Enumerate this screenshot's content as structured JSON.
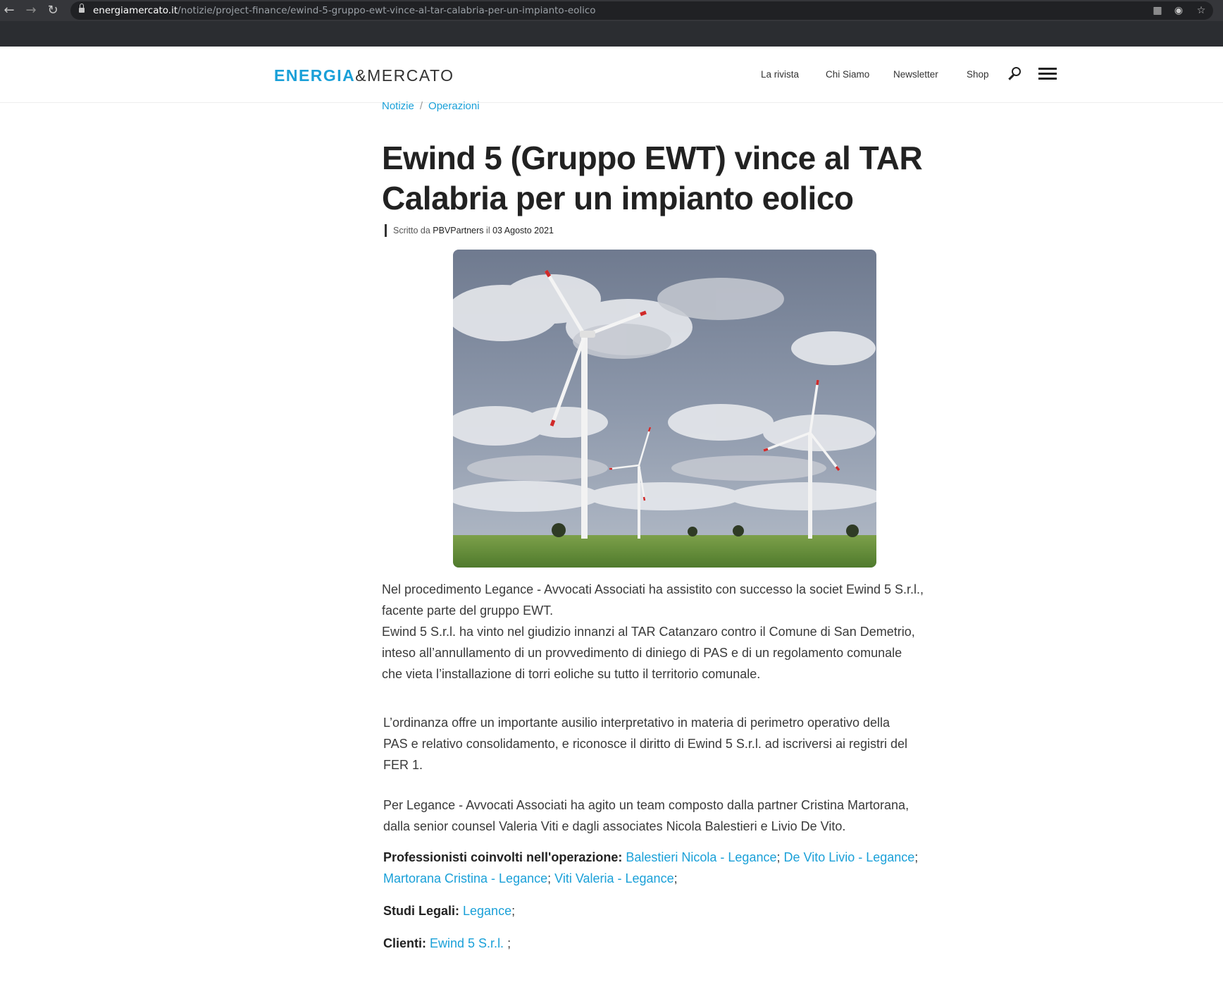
{
  "browser": {
    "url_host": "energiamercato.it",
    "url_path": "/notizie/project-finance/ewind-5-gruppo-ewt-vince-al-tar-calabria-per-un-impianto-eolico",
    "back_icon": "arrow-left-icon",
    "forward_icon": "arrow-right-icon",
    "reload_icon": "reload-icon"
  },
  "header": {
    "logo_part1": "ENERGIA",
    "logo_part2": "&MERCATO",
    "nav": [
      "La rivista",
      "Chi Siamo",
      "Newsletter",
      "Shop"
    ],
    "accent_color": "#1aa0d8"
  },
  "breadcrumb": {
    "items": [
      "Notizie",
      "Operazioni"
    ],
    "separator": "/"
  },
  "article": {
    "title": "Ewind 5 (Gruppo EWT) vince al TAR Calabria per un impianto eolico",
    "byline_prefix": "Scritto da",
    "author": "PBVPartners",
    "date_prefix": "il",
    "date": "03 Agosto 2021",
    "p1_line1": "Nel procedimento Legance - Avvocati Associati ha assistito con successo la societ Ewind 5 S.r.l.,",
    "p1_line2": "facente parte del gruppo EWT.",
    "p1_line3": "Ewind 5 S.r.l. ha vinto nel giudizio innanzi al TAR Catanzaro contro il Comune di San Demetrio,",
    "p1_line4": "inteso all’annullamento di un provvedimento di diniego di PAS e di un regolamento comunale",
    "p1_line5": "che vieta l’installazione di torri eoliche su tutto il territorio comunale.",
    "p2_line1": "L’ordinanza offre un importante ausilio interpretativo in materia di perimetro operativo della",
    "p2_line2": "PAS e relativo consolidamento, e riconosce il diritto di Ewind 5 S.r.l. ad iscriversi ai registri del",
    "p2_line3": "FER 1.",
    "p3_line1": "Per Legance - Avvocati Associati ha agito un team composto dalla partner Cristina Martorana,",
    "p3_line2": "dalla senior counsel Valeria Viti e dagli associates Nicola Balestieri e Livio De Vito.",
    "professionisti_label": "Professionisti coinvolti nell'operazione:",
    "professionisti": [
      "Balestieri Nicola - Legance",
      "De Vito Livio - Legance",
      "Martorana Cristina - Legance",
      "Viti Valeria - Legance"
    ],
    "studi_label": "Studi Legali:",
    "studi": [
      "Legance"
    ],
    "clienti_label": "Clienti:",
    "clienti": [
      "Ewind 5 S.r.l. "
    ]
  }
}
